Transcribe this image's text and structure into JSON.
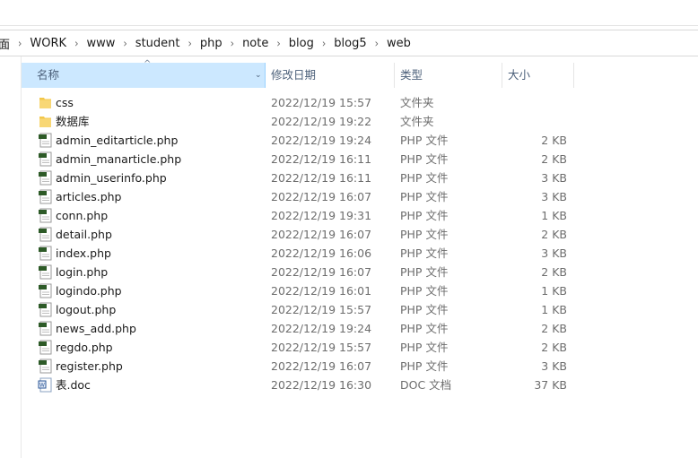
{
  "breadcrumb": [
    "面",
    "WORK",
    "www",
    "student",
    "php",
    "note",
    "blog",
    "blog5",
    "web"
  ],
  "columns": {
    "name": "名称",
    "date": "修改日期",
    "type": "类型",
    "size": "大小"
  },
  "files": [
    {
      "name": "css",
      "date": "2022/12/19 15:57",
      "type": "文件夹",
      "size": "",
      "icon": "folder-icon"
    },
    {
      "name": "数据库",
      "date": "2022/12/19 19:22",
      "type": "文件夹",
      "size": "",
      "icon": "folder-icon"
    },
    {
      "name": "admin_editarticle.php",
      "date": "2022/12/19 19:24",
      "type": "PHP 文件",
      "size": "2 KB",
      "icon": "php-file-icon"
    },
    {
      "name": "admin_manarticle.php",
      "date": "2022/12/19 16:11",
      "type": "PHP 文件",
      "size": "2 KB",
      "icon": "php-file-icon"
    },
    {
      "name": "admin_userinfo.php",
      "date": "2022/12/19 16:11",
      "type": "PHP 文件",
      "size": "3 KB",
      "icon": "php-file-icon"
    },
    {
      "name": "articles.php",
      "date": "2022/12/19 16:07",
      "type": "PHP 文件",
      "size": "3 KB",
      "icon": "php-file-icon"
    },
    {
      "name": "conn.php",
      "date": "2022/12/19 19:31",
      "type": "PHP 文件",
      "size": "1 KB",
      "icon": "php-file-icon"
    },
    {
      "name": "detail.php",
      "date": "2022/12/19 16:07",
      "type": "PHP 文件",
      "size": "2 KB",
      "icon": "php-file-icon"
    },
    {
      "name": "index.php",
      "date": "2022/12/19 16:06",
      "type": "PHP 文件",
      "size": "3 KB",
      "icon": "php-file-icon"
    },
    {
      "name": "login.php",
      "date": "2022/12/19 16:07",
      "type": "PHP 文件",
      "size": "2 KB",
      "icon": "php-file-icon"
    },
    {
      "name": "logindo.php",
      "date": "2022/12/19 16:01",
      "type": "PHP 文件",
      "size": "1 KB",
      "icon": "php-file-icon"
    },
    {
      "name": "logout.php",
      "date": "2022/12/19 15:57",
      "type": "PHP 文件",
      "size": "1 KB",
      "icon": "php-file-icon"
    },
    {
      "name": "news_add.php",
      "date": "2022/12/19 19:24",
      "type": "PHP 文件",
      "size": "2 KB",
      "icon": "php-file-icon"
    },
    {
      "name": "regdo.php",
      "date": "2022/12/19 15:57",
      "type": "PHP 文件",
      "size": "2 KB",
      "icon": "php-file-icon"
    },
    {
      "name": "register.php",
      "date": "2022/12/19 16:07",
      "type": "PHP 文件",
      "size": "3 KB",
      "icon": "php-file-icon"
    },
    {
      "name": "表.doc",
      "date": "2022/12/19 16:30",
      "type": "DOC 文档",
      "size": "37 KB",
      "icon": "doc-file-icon"
    }
  ],
  "colors": {
    "header_selected": "#cce8ff",
    "folder": "#f3c74a",
    "php_icon": "#2d5a27"
  }
}
